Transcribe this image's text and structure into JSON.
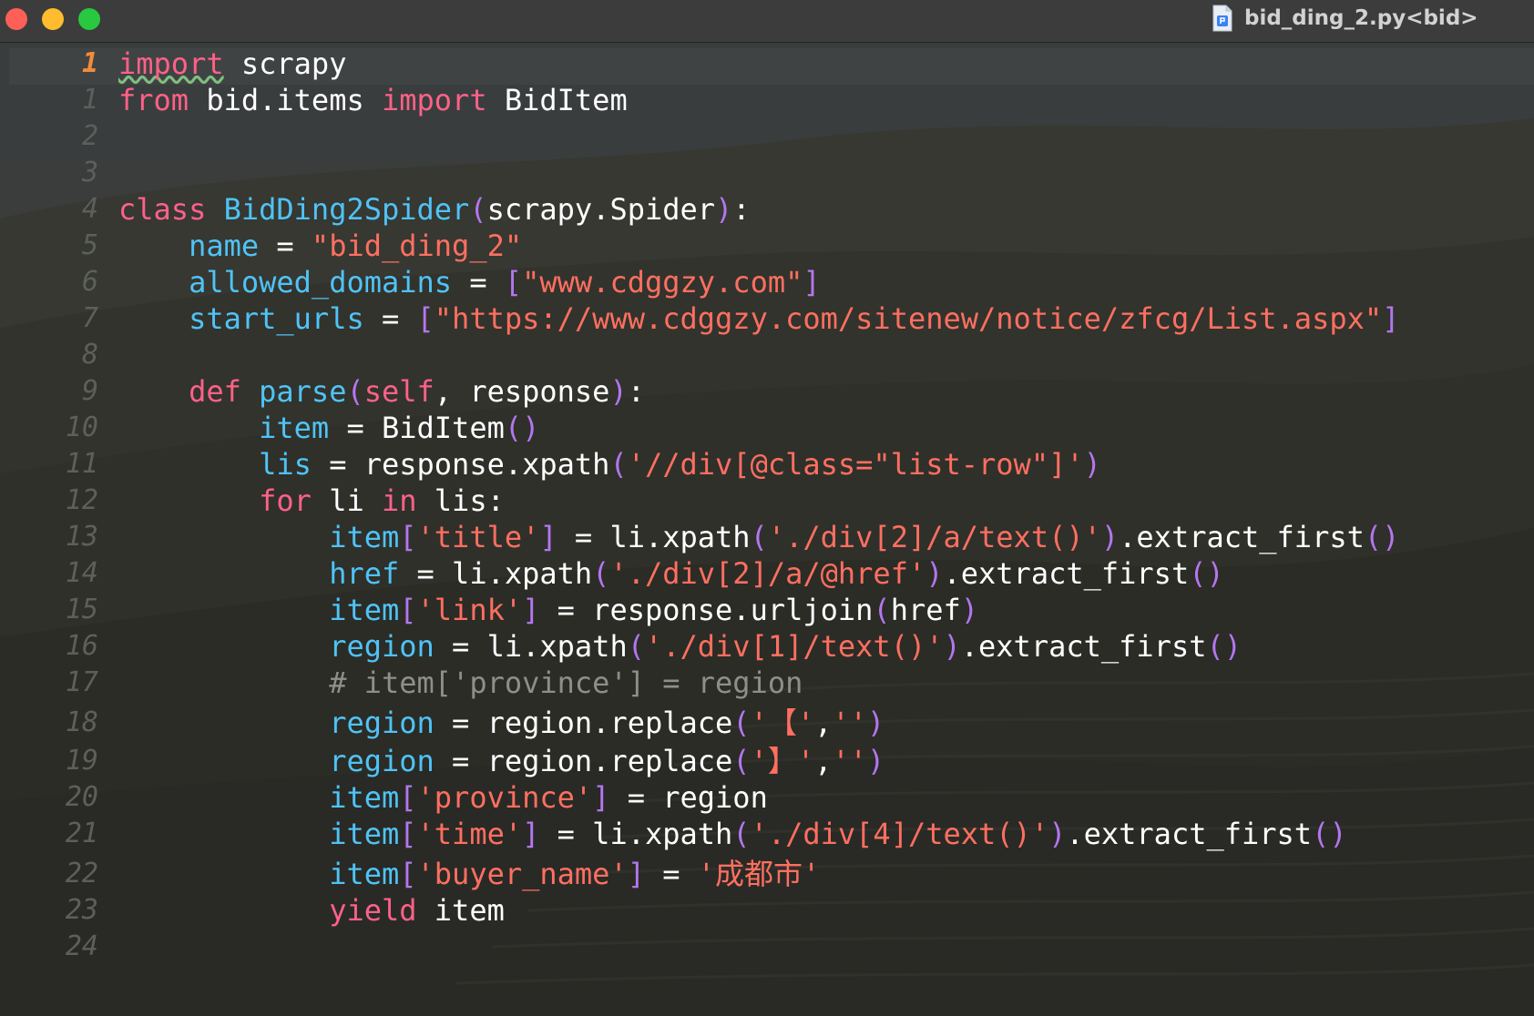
{
  "window": {
    "title": "bid_ding_2.py<bid>",
    "file_icon": "python-file-icon"
  },
  "colors": {
    "keyword": "#ff6188",
    "name": "#4fc3f7",
    "string": "#ff6f61",
    "paren": "#b476f0",
    "comment": "#8d8f8a",
    "current_line_number": "#f28b3c"
  },
  "editor": {
    "lines": [
      {
        "num": "1",
        "current": true,
        "tokens": [
          {
            "t": "import",
            "c": "import"
          },
          {
            "t": " scrapy",
            "c": "plain"
          }
        ]
      },
      {
        "num": "1",
        "tokens": [
          {
            "t": "from",
            "c": "kw"
          },
          {
            "t": " bid.items ",
            "c": "plain"
          },
          {
            "t": "import",
            "c": "kw"
          },
          {
            "t": " BidItem",
            "c": "plain"
          }
        ]
      },
      {
        "num": "2",
        "tokens": []
      },
      {
        "num": "3",
        "tokens": []
      },
      {
        "num": "4",
        "tokens": [
          {
            "t": "class",
            "c": "kw"
          },
          {
            "t": " ",
            "c": "plain"
          },
          {
            "t": "BidDing2Spider",
            "c": "name"
          },
          {
            "t": "(",
            "c": "paren"
          },
          {
            "t": "scrapy.Spider",
            "c": "plain"
          },
          {
            "t": ")",
            "c": "paren"
          },
          {
            "t": ":",
            "c": "plain"
          }
        ]
      },
      {
        "num": "5",
        "tokens": [
          {
            "t": "    ",
            "c": "plain"
          },
          {
            "t": "name",
            "c": "name"
          },
          {
            "t": " = ",
            "c": "plain"
          },
          {
            "t": "\"bid_ding_2\"",
            "c": "str"
          }
        ]
      },
      {
        "num": "6",
        "tokens": [
          {
            "t": "    ",
            "c": "plain"
          },
          {
            "t": "allowed_domains",
            "c": "name"
          },
          {
            "t": " = ",
            "c": "plain"
          },
          {
            "t": "[",
            "c": "paren"
          },
          {
            "t": "\"www.cdggzy.com\"",
            "c": "str"
          },
          {
            "t": "]",
            "c": "paren"
          }
        ]
      },
      {
        "num": "7",
        "tokens": [
          {
            "t": "    ",
            "c": "plain"
          },
          {
            "t": "start_urls",
            "c": "name"
          },
          {
            "t": " = ",
            "c": "plain"
          },
          {
            "t": "[",
            "c": "paren"
          },
          {
            "t": "\"https://www.cdggzy.com/sitenew/notice/zfcg/List.aspx\"",
            "c": "str"
          },
          {
            "t": "]",
            "c": "paren"
          }
        ]
      },
      {
        "num": "8",
        "tokens": []
      },
      {
        "num": "9",
        "tokens": [
          {
            "t": "    ",
            "c": "plain"
          },
          {
            "t": "def",
            "c": "kw"
          },
          {
            "t": " ",
            "c": "plain"
          },
          {
            "t": "parse",
            "c": "name"
          },
          {
            "t": "(",
            "c": "paren"
          },
          {
            "t": "self",
            "c": "self"
          },
          {
            "t": ", response",
            "c": "plain"
          },
          {
            "t": ")",
            "c": "paren"
          },
          {
            "t": ":",
            "c": "plain"
          }
        ]
      },
      {
        "num": "10",
        "tokens": [
          {
            "t": "        ",
            "c": "plain"
          },
          {
            "t": "item",
            "c": "name"
          },
          {
            "t": " = BidItem",
            "c": "plain"
          },
          {
            "t": "()",
            "c": "paren"
          }
        ]
      },
      {
        "num": "11",
        "tokens": [
          {
            "t": "        ",
            "c": "plain"
          },
          {
            "t": "lis",
            "c": "name"
          },
          {
            "t": " = response.xpath",
            "c": "plain"
          },
          {
            "t": "(",
            "c": "paren"
          },
          {
            "t": "'//div[@class=\"list-row\"]'",
            "c": "str"
          },
          {
            "t": ")",
            "c": "paren"
          }
        ]
      },
      {
        "num": "12",
        "tokens": [
          {
            "t": "        ",
            "c": "plain"
          },
          {
            "t": "for",
            "c": "kw"
          },
          {
            "t": " li ",
            "c": "plain"
          },
          {
            "t": "in",
            "c": "kw"
          },
          {
            "t": " lis:",
            "c": "plain"
          }
        ]
      },
      {
        "num": "13",
        "tokens": [
          {
            "t": "            ",
            "c": "plain"
          },
          {
            "t": "item",
            "c": "name"
          },
          {
            "t": "[",
            "c": "paren"
          },
          {
            "t": "'title'",
            "c": "str"
          },
          {
            "t": "]",
            "c": "paren"
          },
          {
            "t": " = li.xpath",
            "c": "plain"
          },
          {
            "t": "(",
            "c": "paren"
          },
          {
            "t": "'./div[2]/a/text()'",
            "c": "str"
          },
          {
            "t": ")",
            "c": "paren"
          },
          {
            "t": ".extract_first",
            "c": "plain"
          },
          {
            "t": "()",
            "c": "paren"
          }
        ]
      },
      {
        "num": "14",
        "tokens": [
          {
            "t": "            ",
            "c": "plain"
          },
          {
            "t": "href",
            "c": "name"
          },
          {
            "t": " = li.xpath",
            "c": "plain"
          },
          {
            "t": "(",
            "c": "paren"
          },
          {
            "t": "'./div[2]/a/@href'",
            "c": "str"
          },
          {
            "t": ")",
            "c": "paren"
          },
          {
            "t": ".extract_first",
            "c": "plain"
          },
          {
            "t": "()",
            "c": "paren"
          }
        ]
      },
      {
        "num": "15",
        "tokens": [
          {
            "t": "            ",
            "c": "plain"
          },
          {
            "t": "item",
            "c": "name"
          },
          {
            "t": "[",
            "c": "paren"
          },
          {
            "t": "'link'",
            "c": "str"
          },
          {
            "t": "]",
            "c": "paren"
          },
          {
            "t": " = response.urljoin",
            "c": "plain"
          },
          {
            "t": "(",
            "c": "paren"
          },
          {
            "t": "href",
            "c": "plain"
          },
          {
            "t": ")",
            "c": "paren"
          }
        ]
      },
      {
        "num": "16",
        "tokens": [
          {
            "t": "            ",
            "c": "plain"
          },
          {
            "t": "region",
            "c": "name"
          },
          {
            "t": " = li.xpath",
            "c": "plain"
          },
          {
            "t": "(",
            "c": "paren"
          },
          {
            "t": "'./div[1]/text()'",
            "c": "str"
          },
          {
            "t": ")",
            "c": "paren"
          },
          {
            "t": ".extract_first",
            "c": "plain"
          },
          {
            "t": "()",
            "c": "paren"
          }
        ]
      },
      {
        "num": "17",
        "tokens": [
          {
            "t": "            ",
            "c": "plain"
          },
          {
            "t": "# item['province'] = region",
            "c": "comment"
          }
        ]
      },
      {
        "num": "18",
        "tokens": [
          {
            "t": "            ",
            "c": "plain"
          },
          {
            "t": "region",
            "c": "name"
          },
          {
            "t": " = region.replace",
            "c": "plain"
          },
          {
            "t": "(",
            "c": "paren"
          },
          {
            "t": "'【'",
            "c": "str"
          },
          {
            "t": ",",
            "c": "plain"
          },
          {
            "t": "''",
            "c": "str"
          },
          {
            "t": ")",
            "c": "paren"
          }
        ]
      },
      {
        "num": "19",
        "tokens": [
          {
            "t": "            ",
            "c": "plain"
          },
          {
            "t": "region",
            "c": "name"
          },
          {
            "t": " = region.replace",
            "c": "plain"
          },
          {
            "t": "(",
            "c": "paren"
          },
          {
            "t": "'】'",
            "c": "str"
          },
          {
            "t": ",",
            "c": "plain"
          },
          {
            "t": "''",
            "c": "str"
          },
          {
            "t": ")",
            "c": "paren"
          }
        ]
      },
      {
        "num": "20",
        "tokens": [
          {
            "t": "            ",
            "c": "plain"
          },
          {
            "t": "item",
            "c": "name"
          },
          {
            "t": "[",
            "c": "paren"
          },
          {
            "t": "'province'",
            "c": "str"
          },
          {
            "t": "]",
            "c": "paren"
          },
          {
            "t": " = region",
            "c": "plain"
          }
        ]
      },
      {
        "num": "21",
        "tokens": [
          {
            "t": "            ",
            "c": "plain"
          },
          {
            "t": "item",
            "c": "name"
          },
          {
            "t": "[",
            "c": "paren"
          },
          {
            "t": "'time'",
            "c": "str"
          },
          {
            "t": "]",
            "c": "paren"
          },
          {
            "t": " = li.xpath",
            "c": "plain"
          },
          {
            "t": "(",
            "c": "paren"
          },
          {
            "t": "'./div[4]/text()'",
            "c": "str"
          },
          {
            "t": ")",
            "c": "paren"
          },
          {
            "t": ".extract_first",
            "c": "plain"
          },
          {
            "t": "()",
            "c": "paren"
          }
        ]
      },
      {
        "num": "22",
        "tokens": [
          {
            "t": "            ",
            "c": "plain"
          },
          {
            "t": "item",
            "c": "name"
          },
          {
            "t": "[",
            "c": "paren"
          },
          {
            "t": "'buyer_name'",
            "c": "str"
          },
          {
            "t": "]",
            "c": "paren"
          },
          {
            "t": " = ",
            "c": "plain"
          },
          {
            "t": "'成都市'",
            "c": "str"
          }
        ]
      },
      {
        "num": "23",
        "tokens": [
          {
            "t": "            ",
            "c": "plain"
          },
          {
            "t": "yield",
            "c": "kw"
          },
          {
            "t": " item",
            "c": "plain"
          }
        ]
      },
      {
        "num": "24",
        "tokens": []
      }
    ]
  }
}
